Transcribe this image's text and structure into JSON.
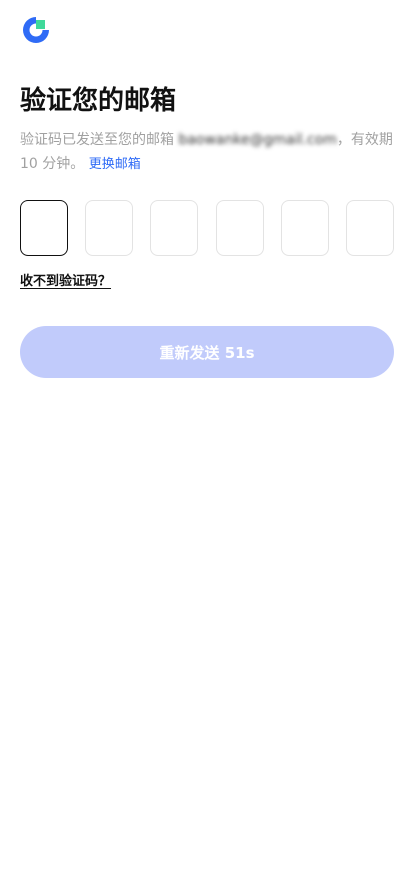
{
  "header": {
    "logo_icon": "brand-logo-icon",
    "colors": {
      "blue": "#2f6bf6",
      "green": "#3fd99a"
    }
  },
  "main": {
    "title": "验证您的邮箱",
    "subtitle_prefix": "验证码已发送至您的邮箱 ",
    "email": "baowanke@gmail.com",
    "subtitle_suffix": "，有效期 10 分钟。",
    "change_email": "更换邮箱"
  },
  "code_inputs": {
    "count": 6,
    "values": [
      "",
      "",
      "",
      "",
      "",
      ""
    ]
  },
  "links": {
    "no_code": "收不到验证码？"
  },
  "buttons": {
    "resend": "重新发送 51s",
    "resend_color": "#c1cbfb"
  }
}
